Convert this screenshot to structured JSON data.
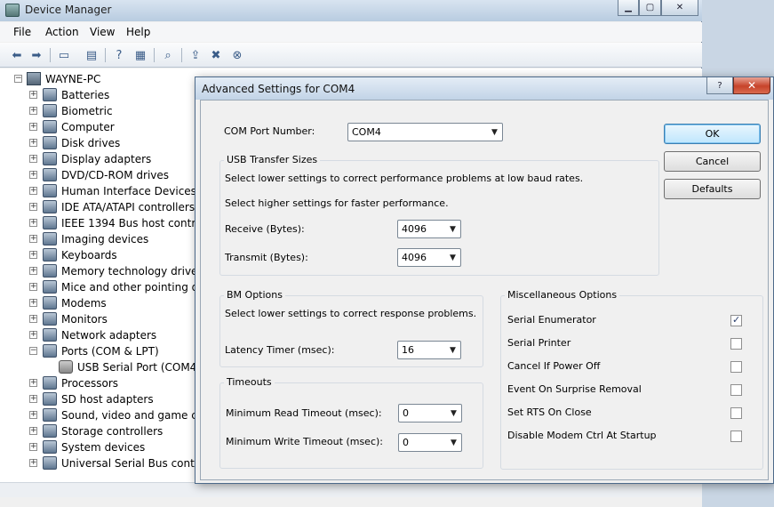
{
  "device_manager": {
    "title": "Device Manager",
    "menu": [
      "File",
      "Action",
      "View",
      "Help"
    ],
    "tree": {
      "root": "WAYNE-PC",
      "categories": [
        {
          "label": "Batteries",
          "icon": "battery-icon"
        },
        {
          "label": "Biometric",
          "icon": "fingerprint-icon"
        },
        {
          "label": "Computer",
          "icon": "computer-icon"
        },
        {
          "label": "Disk drives",
          "icon": "disk-drive-icon"
        },
        {
          "label": "Display adapters",
          "icon": "display-adapter-icon"
        },
        {
          "label": "DVD/CD-ROM drives",
          "icon": "dvd-drive-icon"
        },
        {
          "label": "Human Interface Devices",
          "icon": "hid-icon"
        },
        {
          "label": "IDE ATA/ATAPI controllers",
          "icon": "ide-controller-icon"
        },
        {
          "label": "IEEE 1394 Bus host controllers",
          "icon": "firewire-icon"
        },
        {
          "label": "Imaging devices",
          "icon": "camera-icon"
        },
        {
          "label": "Keyboards",
          "icon": "keyboard-icon"
        },
        {
          "label": "Memory technology driver",
          "icon": "memory-icon"
        },
        {
          "label": "Mice and other pointing devices",
          "icon": "mouse-icon"
        },
        {
          "label": "Modems",
          "icon": "modem-icon"
        },
        {
          "label": "Monitors",
          "icon": "monitor-icon"
        },
        {
          "label": "Network adapters",
          "icon": "network-adapter-icon"
        },
        {
          "label": "Ports (COM & LPT)",
          "icon": "port-icon",
          "expanded": true
        },
        {
          "label": "USB Serial Port (COM4)",
          "icon": "port-icon",
          "child": true
        },
        {
          "label": "Processors",
          "icon": "processor-icon"
        },
        {
          "label": "SD host adapters",
          "icon": "sd-card-icon"
        },
        {
          "label": "Sound, video and game controllers",
          "icon": "speaker-icon"
        },
        {
          "label": "Storage controllers",
          "icon": "storage-controller-icon"
        },
        {
          "label": "System devices",
          "icon": "system-device-icon"
        },
        {
          "label": "Universal Serial Bus controllers",
          "icon": "usb-icon"
        }
      ]
    }
  },
  "dialog": {
    "title": "Advanced Settings for COM4",
    "com_port": {
      "label": "COM Port Number:",
      "value": "COM4"
    },
    "usb_transfer": {
      "title": "USB Transfer Sizes",
      "line1": "Select lower settings to correct performance problems at low baud rates.",
      "line2": "Select higher settings for faster performance.",
      "receive_label": "Receive (Bytes):",
      "receive_value": "4096",
      "transmit_label": "Transmit (Bytes):",
      "transmit_value": "4096"
    },
    "bm_options": {
      "title": "BM Options",
      "line": "Select lower settings to correct response problems.",
      "latency_label": "Latency Timer (msec):",
      "latency_value": "16"
    },
    "timeouts": {
      "title": "Timeouts",
      "read_label": "Minimum Read Timeout (msec):",
      "read_value": "0",
      "write_label": "Minimum Write Timeout (msec):",
      "write_value": "0"
    },
    "misc": {
      "title": "Miscellaneous Options",
      "options": [
        {
          "label": "Serial Enumerator",
          "checked": true
        },
        {
          "label": "Serial Printer",
          "checked": false
        },
        {
          "label": "Cancel If Power Off",
          "checked": false
        },
        {
          "label": "Event On Surprise Removal",
          "checked": false
        },
        {
          "label": "Set RTS On Close",
          "checked": false
        },
        {
          "label": "Disable Modem Ctrl At Startup",
          "checked": false
        }
      ]
    },
    "buttons": {
      "ok": "OK",
      "cancel": "Cancel",
      "defaults": "Defaults"
    },
    "help_glyph": "?",
    "close_glyph": "✕"
  },
  "colors": {
    "accent": "#3c7fb1",
    "close": "#c7432a",
    "titlebar": "#c2d4e7"
  }
}
